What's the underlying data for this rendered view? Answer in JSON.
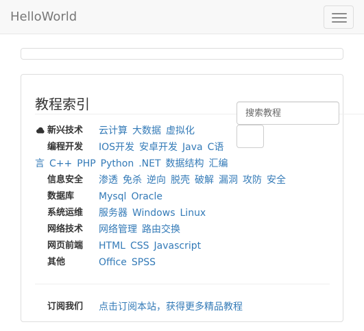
{
  "navbar": {
    "brand": "HelloWorld"
  },
  "panel": {
    "title": "教程索引",
    "search": {
      "placeholder": "搜索教程"
    },
    "categories": [
      {
        "label": "新兴技术",
        "links": [
          "云计算",
          "大数据",
          "虚拟化"
        ]
      },
      {
        "label": "编程开发",
        "links": [
          "IOS开发",
          "安卓开发",
          "Java",
          "C语"
        ],
        "wrap_links": [
          "言",
          "C++",
          "PHP",
          "Python",
          ".NET",
          "数据结构",
          "汇编"
        ]
      },
      {
        "label": "信息安全",
        "links": [
          "渗透",
          "免杀",
          "逆向",
          "脱壳",
          "破解",
          "漏洞",
          "攻防",
          "安全"
        ]
      },
      {
        "label": "数据库",
        "links": [
          "Mysql",
          "Oracle"
        ]
      },
      {
        "label": "系统运维",
        "links": [
          "服务器",
          "Windows",
          "Linux"
        ]
      },
      {
        "label": "网络技术",
        "links": [
          "网络管理",
          "路由交换"
        ]
      },
      {
        "label": "网页前端",
        "links": [
          "HTML",
          "CSS",
          "Javascript"
        ]
      },
      {
        "label": "其他",
        "links": [
          "Office",
          "SPSS"
        ]
      }
    ],
    "subscribe": {
      "label": "订阅我们",
      "link": "点击订阅本站，获得更多精品教程"
    }
  }
}
